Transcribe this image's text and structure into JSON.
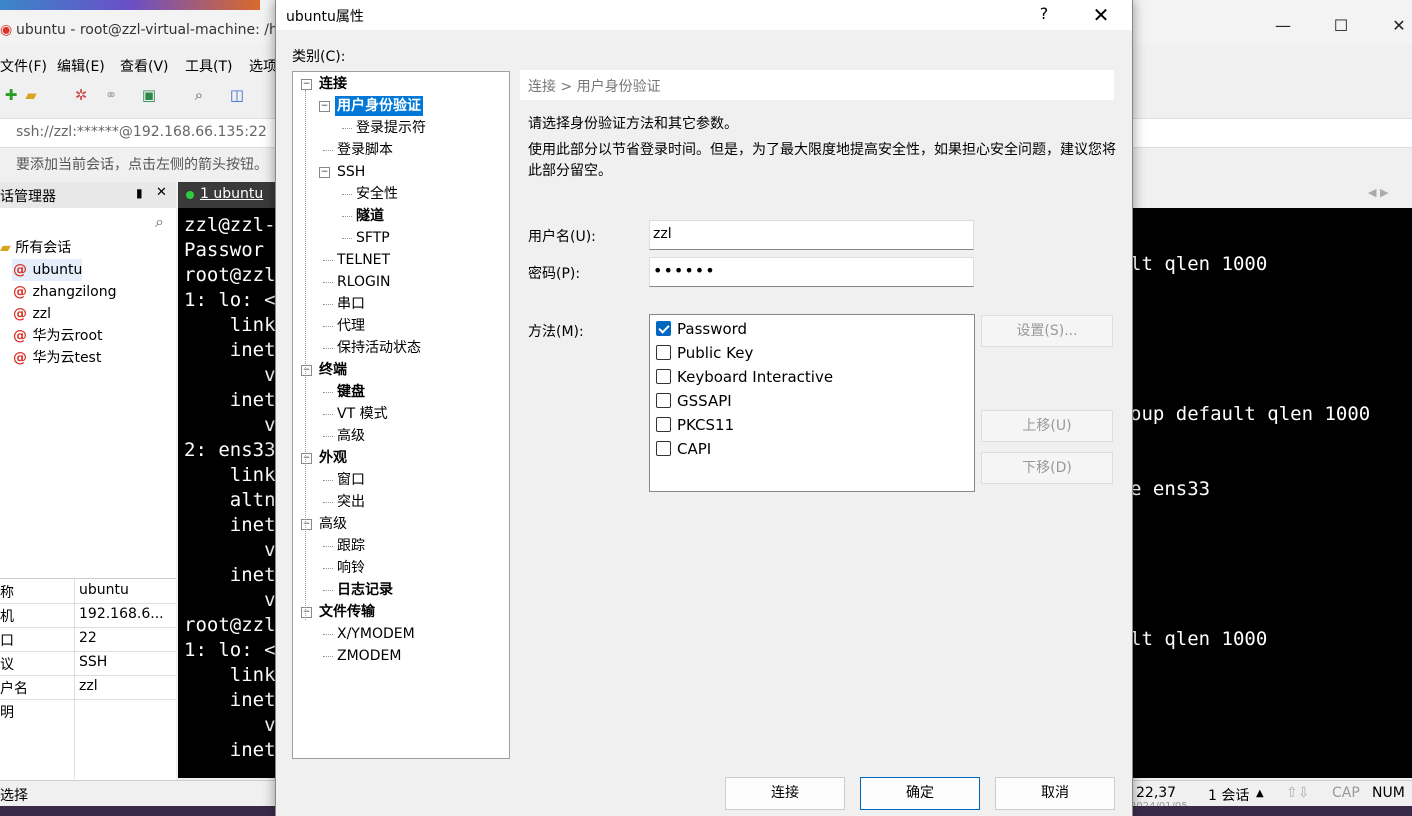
{
  "main_window": {
    "title": "ubuntu - root@zzl-virtual-machine: /hom",
    "menu": [
      "文件(F)",
      "编辑(E)",
      "查看(V)",
      "工具(T)",
      "选项"
    ],
    "address": "ssh://zzl:******@192.168.66.135:22",
    "hint": "要添加当前会话，点击左侧的箭头按钮。",
    "status_left": "选择",
    "status_right": {
      "pos": "22,37",
      "sessions": "1 会话",
      "caps": "CAP",
      "num": "NUM",
      "date": "2024/01/05"
    }
  },
  "session_manager": {
    "title": "话管理器",
    "pin": "☰",
    "close": "✕",
    "root": "所有会话",
    "sessions": [
      "ubuntu",
      "zhangzilong",
      "zzl",
      "华为云root",
      "华为云test"
    ],
    "properties": [
      {
        "key": "称",
        "value": "ubuntu"
      },
      {
        "key": "机",
        "value": "192.168.6..."
      },
      {
        "key": "口",
        "value": "22"
      },
      {
        "key": "议",
        "value": "SSH"
      },
      {
        "key": "户名",
        "value": "zzl"
      },
      {
        "key": "明",
        "value": ""
      }
    ]
  },
  "terminal_tab": {
    "label": "1 ubuntu"
  },
  "terminal_lines": [
    "zzl@zzl-",
    "Passwor",
    "root@zzl",
    "1: lo: <",
    "    link",
    "    inet",
    "       v",
    "    inet",
    "       v",
    "2: ens33",
    "    link",
    "    altn",
    "    inet",
    "       v",
    "    inet",
    "       v",
    "root@zzl",
    "1: lo: <",
    "    link",
    "    inet",
    "       v",
    "    inet"
  ],
  "terminal_right_lines": [
    {
      "text": "lt qlen 1000",
      "row": 2
    },
    {
      "text": "oup default qlen 1000",
      "row": 8
    },
    {
      "text": "e ens33",
      "row": 11
    },
    {
      "text": "lt qlen 1000",
      "row": 17
    }
  ],
  "dialog": {
    "title": "ubuntu属性",
    "help": "?",
    "close": "✕",
    "category_label": "类别(C):",
    "tree": [
      {
        "label": "连接",
        "level": 0,
        "bold": true,
        "toggle": "−"
      },
      {
        "label": "用户身份验证",
        "level": 1,
        "bold": true,
        "selected": true,
        "toggle": "−"
      },
      {
        "label": "登录提示符",
        "level": 2
      },
      {
        "label": "登录脚本",
        "level": 1
      },
      {
        "label": "SSH",
        "level": 1,
        "toggle": "−"
      },
      {
        "label": "安全性",
        "level": 2
      },
      {
        "label": "隧道",
        "level": 2,
        "bold": true
      },
      {
        "label": "SFTP",
        "level": 2
      },
      {
        "label": "TELNET",
        "level": 1
      },
      {
        "label": "RLOGIN",
        "level": 1
      },
      {
        "label": "串口",
        "level": 1
      },
      {
        "label": "代理",
        "level": 1
      },
      {
        "label": "保持活动状态",
        "level": 1
      },
      {
        "label": "终端",
        "level": 0,
        "bold": true,
        "toggle": "−"
      },
      {
        "label": "键盘",
        "level": 1,
        "bold": true
      },
      {
        "label": "VT 模式",
        "level": 1
      },
      {
        "label": "高级",
        "level": 1
      },
      {
        "label": "外观",
        "level": 0,
        "bold": true,
        "toggle": "−"
      },
      {
        "label": "窗口",
        "level": 1
      },
      {
        "label": "突出",
        "level": 1
      },
      {
        "label": "高级",
        "level": 0,
        "toggle": "−"
      },
      {
        "label": "跟踪",
        "level": 1
      },
      {
        "label": "响铃",
        "level": 1
      },
      {
        "label": "日志记录",
        "level": 1,
        "bold": true
      },
      {
        "label": "文件传输",
        "level": 0,
        "bold": true,
        "toggle": "−"
      },
      {
        "label": "X/YMODEM",
        "level": 1
      },
      {
        "label": "ZMODEM",
        "level": 1
      }
    ],
    "breadcrumb": "连接 > 用户身份验证",
    "description": "请选择身份验证方法和其它参数。",
    "description2": "使用此部分以节省登录时间。但是，为了最大限度地提高安全性，如果担心安全问题，建议您将此部分留空。",
    "username_label": "用户名(U):",
    "username_value": "zzl",
    "password_label": "密码(P):",
    "password_value": "••••••",
    "method_label": "方法(M):",
    "methods": [
      {
        "label": "Password",
        "checked": true
      },
      {
        "label": "Public Key",
        "checked": false
      },
      {
        "label": "Keyboard Interactive",
        "checked": false
      },
      {
        "label": "GSSAPI",
        "checked": false
      },
      {
        "label": "PKCS11",
        "checked": false
      },
      {
        "label": "CAPI",
        "checked": false
      }
    ],
    "settings_button": "设置(S)...",
    "move_up_button": "上移(U)",
    "move_down_button": "下移(D)",
    "connect_button": "连接",
    "ok_button": "确定",
    "cancel_button": "取消"
  },
  "colors": {
    "selection": "#0078d7",
    "checkbox": "#0067c0",
    "terminal_bg": "#000000"
  }
}
